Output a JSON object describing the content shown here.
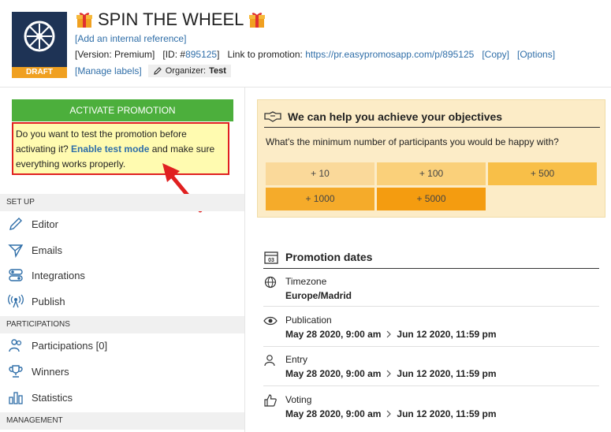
{
  "header": {
    "title": "SPIN THE WHEEL",
    "status": "DRAFT",
    "add_reference": "[Add an internal reference]",
    "version": "[Version: Premium]",
    "id_prefix": "[ID: #",
    "id_value": "895125",
    "id_suffix": "]",
    "link_label": "Link to promotion:",
    "link_url": "https://pr.easypromosapp.com/p/895125",
    "copy": "[Copy]",
    "options": "[Options]",
    "manage_labels": "[Manage labels]",
    "organizer_label": "Organizer:",
    "organizer_value": "Test"
  },
  "left": {
    "activate": "ACTIVATE PROMOTION",
    "test_text_1": "Do you want to test the promotion before activating it?",
    "test_link": "Enable test mode",
    "test_text_2": "and make sure everything works properly.",
    "sections": [
      {
        "title": "SET UP",
        "items": [
          "Editor",
          "Emails",
          "Integrations",
          "Publish"
        ]
      },
      {
        "title": "PARTICIPATIONS",
        "items": [
          "Participations [0]",
          "Winners",
          "Statistics"
        ]
      },
      {
        "title": "MANAGEMENT",
        "items": []
      }
    ]
  },
  "objectives": {
    "title": "We can help you achieve your objectives",
    "question": "What's the minimum number of participants you would be happy with?",
    "options": [
      "+ 10",
      "+ 100",
      "+ 500",
      "+ 1000",
      "+ 5000"
    ],
    "colors": [
      "#fad99a",
      "#fad07a",
      "#f8bf48",
      "#f5ab2a",
      "#f49c10"
    ]
  },
  "dates": {
    "title": "Promotion dates",
    "timezone_label": "Timezone",
    "timezone_value": "Europe/Madrid",
    "publication_label": "Publication",
    "publication_start": "May 28 2020, 9:00 am",
    "publication_end": "Jun 12 2020, 11:59 pm",
    "entry_label": "Entry",
    "entry_start": "May 28 2020, 9:00 am",
    "entry_end": "Jun 12 2020, 11:59 pm",
    "voting_label": "Voting",
    "voting_start": "May 28 2020, 9:00 am",
    "voting_end": "Jun 12 2020, 11:59 pm"
  },
  "colors": {
    "accent_green": "#4caf3c",
    "draft_orange": "#f0a020",
    "link_blue": "#2f6ea8",
    "highlight_red": "#e02020"
  }
}
